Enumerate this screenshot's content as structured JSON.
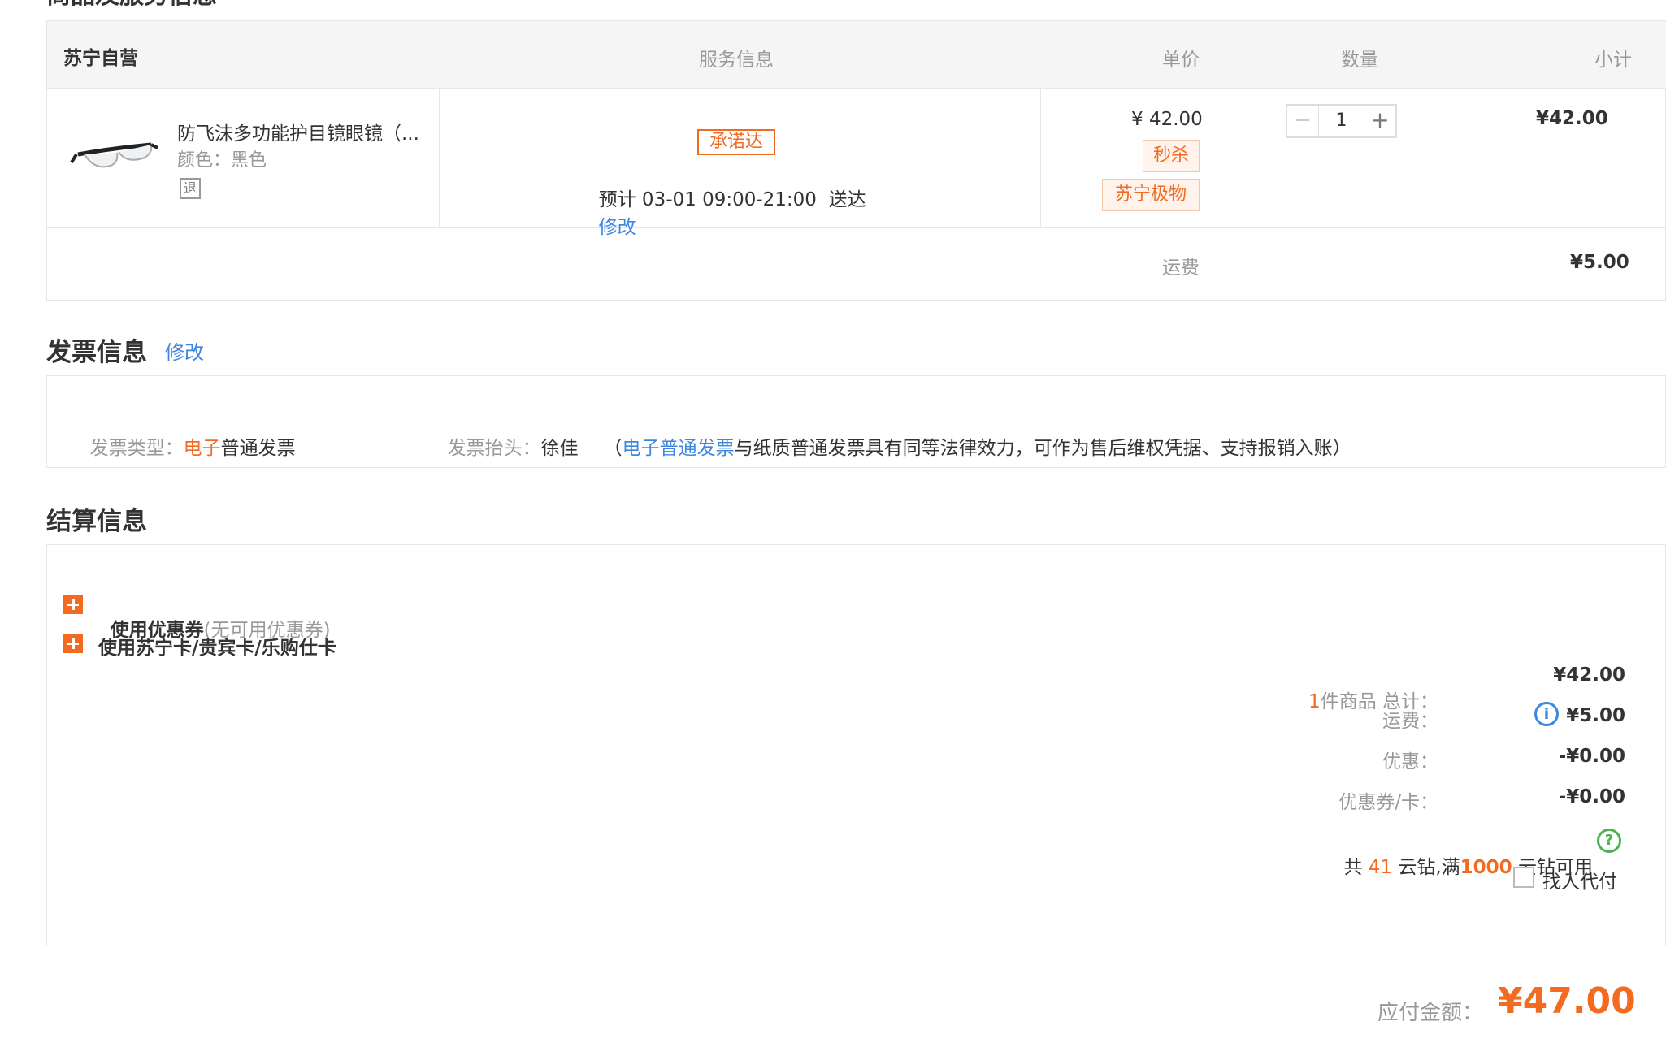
{
  "items_section": {
    "partial_title": "商品及服务信息",
    "header": {
      "store": "苏宁自营",
      "service": "服务信息",
      "unit_price": "单价",
      "quantity": "数量",
      "subtotal": "小计"
    },
    "product": {
      "name": "防飞沫多功能护目镜眼镜（...",
      "color_label": "颜色：",
      "color_value": "黑色",
      "return_icon": "退",
      "service_badge": "承诺达",
      "delivery": "预计 03-01 09:00-21:00  送达",
      "modify": "修改",
      "price": "¥ 42.00",
      "tags": [
        "秒杀",
        "苏宁极物"
      ],
      "qty": "1",
      "subtotal": "¥42.00"
    },
    "shipping_label": "运费",
    "shipping_value": "¥5.00"
  },
  "invoice": {
    "title": "发票信息",
    "modify": "修改",
    "type_label": "发票类型：",
    "type_prefix": "电子",
    "type_suffix": "普通发票",
    "header_label": "发票抬头：",
    "header_value": "徐佳",
    "note_open": "（",
    "note_link": "电子普通发票",
    "note_rest": "与纸质普通发票具有同等法律效力，可作为售后维权凭据、支持报销入账）"
  },
  "settlement": {
    "title": "结算信息",
    "coupon_label": "使用优惠券",
    "coupon_note": "(无可用优惠券)",
    "card_label": "使用苏宁卡/贵宾卡/乐购仕卡",
    "count": "1",
    "total_label": "件商品 总计：",
    "total_value": "¥42.00",
    "freight_label": "运费：",
    "freight_value": "¥5.00",
    "discount_label": "优惠：",
    "discount_value": "-¥0.00",
    "coupon_card_label": "优惠券/卡：",
    "coupon_card_value": "-¥0.00",
    "diamond_pre": "共",
    "diamond_count": "41",
    "diamond_mid": "云钻,满",
    "diamond_threshold": "1000",
    "diamond_post": "云钻可用",
    "proxy_pay": "找人代付"
  },
  "payable": {
    "label": "应付金额：",
    "value": "¥47.00"
  },
  "colors": {
    "accent": "#f36b21",
    "link": "#3d87e0",
    "border": "#e6e6e6",
    "header_bg": "#f5f5f5"
  }
}
